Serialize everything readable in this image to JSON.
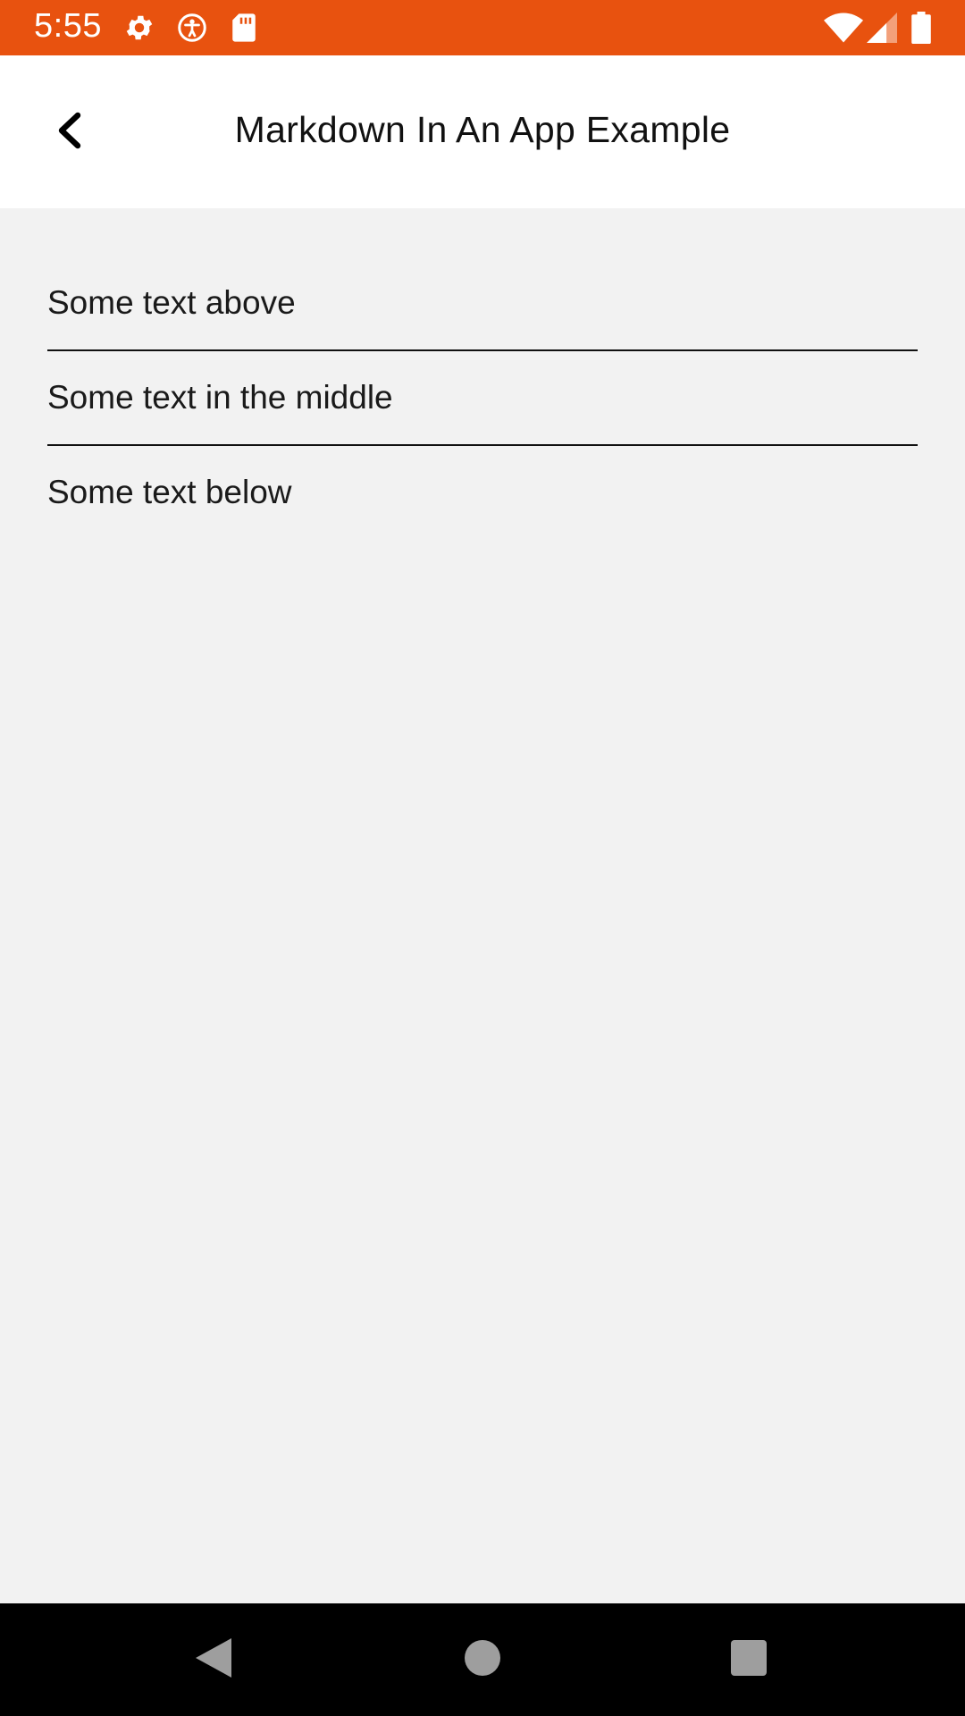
{
  "colors": {
    "status_bar": "#e8520f",
    "app_bar": "#ffffff",
    "background": "#f2f2f2",
    "nav_bar": "#000000",
    "nav_icons": "#9e9e9e"
  },
  "status_bar": {
    "time": "5:55",
    "left_icons": [
      "gear-icon",
      "accessibility-icon",
      "sd-card-icon"
    ],
    "right_icons": [
      "wifi-icon",
      "signal-icon",
      "battery-icon"
    ]
  },
  "app_bar": {
    "back_icon": "chevron-left-icon",
    "title": "Markdown In An App Example"
  },
  "content": {
    "lines": [
      "Some text above",
      "Some text in the middle",
      "Some text below"
    ]
  },
  "nav_bar": {
    "buttons": [
      "back-triangle-icon",
      "home-circle-icon",
      "recents-square-icon"
    ]
  }
}
